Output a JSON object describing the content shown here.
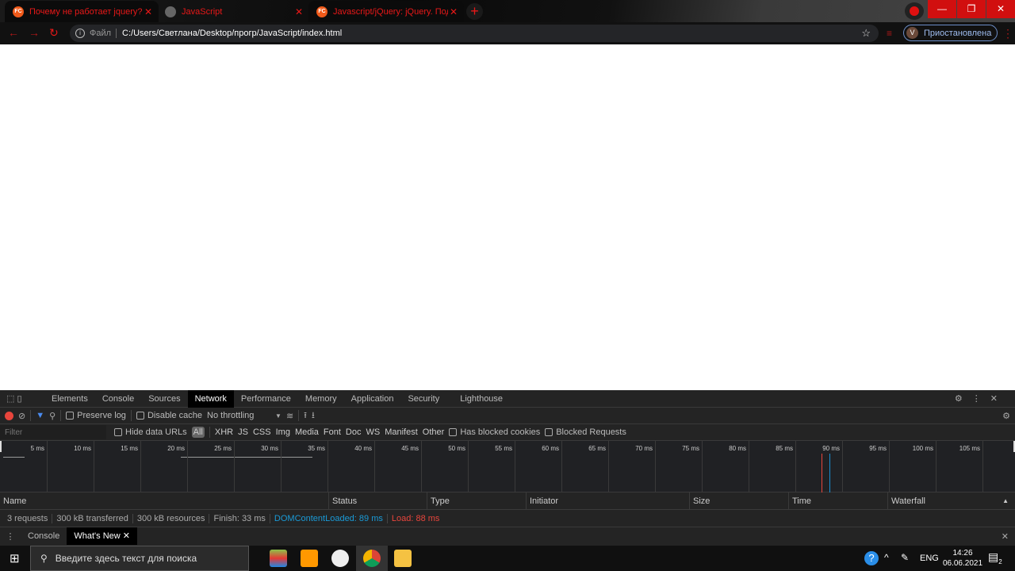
{
  "browser": {
    "tabs": [
      {
        "title": "Почему не работает jquery?",
        "favicon": "FC",
        "active": true
      },
      {
        "title": "JavaScript",
        "favicon": "globe",
        "active": false
      },
      {
        "title": "Javascript/jQuery: jQuery. Подкл",
        "favicon": "FC",
        "active": true
      }
    ],
    "address": {
      "scheme_label": "Файл",
      "url": "C:/Users/Светлана/Desktop/прогр/JavaScript/index.html"
    },
    "profile": {
      "initial": "V",
      "status": "Приостановлена"
    },
    "accent": "#e81818"
  },
  "devtools": {
    "tabs": [
      "Elements",
      "Console",
      "Sources",
      "Network",
      "Performance",
      "Memory",
      "Application",
      "Security",
      "Lighthouse"
    ],
    "active_tab": "Network",
    "toolbar": {
      "preserve_log": "Preserve log",
      "disable_cache": "Disable cache",
      "throttling": "No throttling"
    },
    "filter": {
      "placeholder": "Filter",
      "hide_data_urls": "Hide data URLs",
      "types": [
        "All",
        "XHR",
        "JS",
        "CSS",
        "Img",
        "Media",
        "Font",
        "Doc",
        "WS",
        "Manifest",
        "Other"
      ],
      "has_blocked_cookies": "Has blocked cookies",
      "blocked_requests": "Blocked Requests"
    },
    "timeline_ticks": [
      "5 ms",
      "10 ms",
      "15 ms",
      "20 ms",
      "25 ms",
      "30 ms",
      "35 ms",
      "40 ms",
      "45 ms",
      "50 ms",
      "55 ms",
      "60 ms",
      "65 ms",
      "70 ms",
      "75 ms",
      "80 ms",
      "85 ms",
      "90 ms",
      "95 ms",
      "100 ms",
      "105 ms"
    ],
    "columns": [
      "Name",
      "Status",
      "Type",
      "Initiator",
      "Size",
      "Time",
      "Waterfall"
    ],
    "summary": {
      "requests": "3 requests",
      "transferred": "300 kB transferred",
      "resources": "300 kB resources",
      "finish": "Finish: 33 ms",
      "dcl": "DOMContentLoaded: 89 ms",
      "load": "Load: 88 ms"
    },
    "drawer_tabs": [
      "Console",
      "What's New"
    ]
  },
  "taskbar": {
    "search_placeholder": "Введите здесь текст для поиска",
    "lang": "ENG",
    "time": "14:26",
    "date": "06.06.2021",
    "notifications": "2"
  }
}
